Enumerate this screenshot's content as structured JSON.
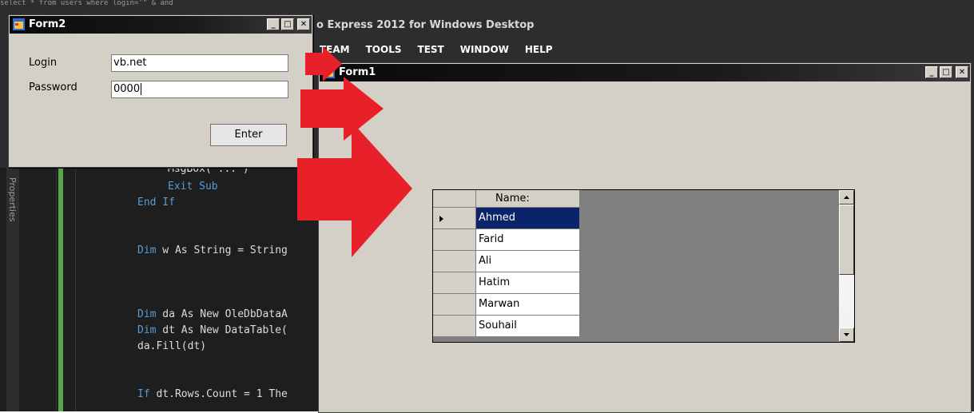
{
  "vs": {
    "title": "o Express 2012 for Windows Desktop",
    "menu": [
      "TEAM",
      "TOOLS",
      "TEST",
      "WINDOW",
      "HELP"
    ],
    "side_tab": "Properties",
    "code_lines": [
      {
        "text": "MsgBox(\"...\")"
      },
      {
        "kw": "Exit Sub",
        "text": ""
      },
      {
        "kw": "End If",
        "text": ""
      },
      {
        "kw": "Dim",
        "text": " w As String = String"
      },
      {
        "kw": "Dim",
        "text": " da As New OleDbDataA"
      },
      {
        "kw": "Dim",
        "text": " dt As New DataTable("
      },
      {
        "kw": "",
        "text": "da.Fill(dt)"
      },
      {
        "kw": "If",
        "text": " dt.Rows.Count = 1 The"
      }
    ]
  },
  "form2": {
    "title": "Form2",
    "login_label": "Login",
    "login_value": "vb.net",
    "password_label": "Password",
    "password_value": "0000",
    "enter_label": "Enter"
  },
  "form1": {
    "title": "Form1",
    "grid": {
      "column": "Name:",
      "rows": [
        "Ahmed",
        "Farid",
        "Ali",
        "Hatim",
        "Marwan",
        "Souhail"
      ],
      "selected_index": 0
    }
  },
  "colors": {
    "arrow": "#e8202a",
    "selection": "#0a246a",
    "vs_background": "#2d2d30"
  }
}
